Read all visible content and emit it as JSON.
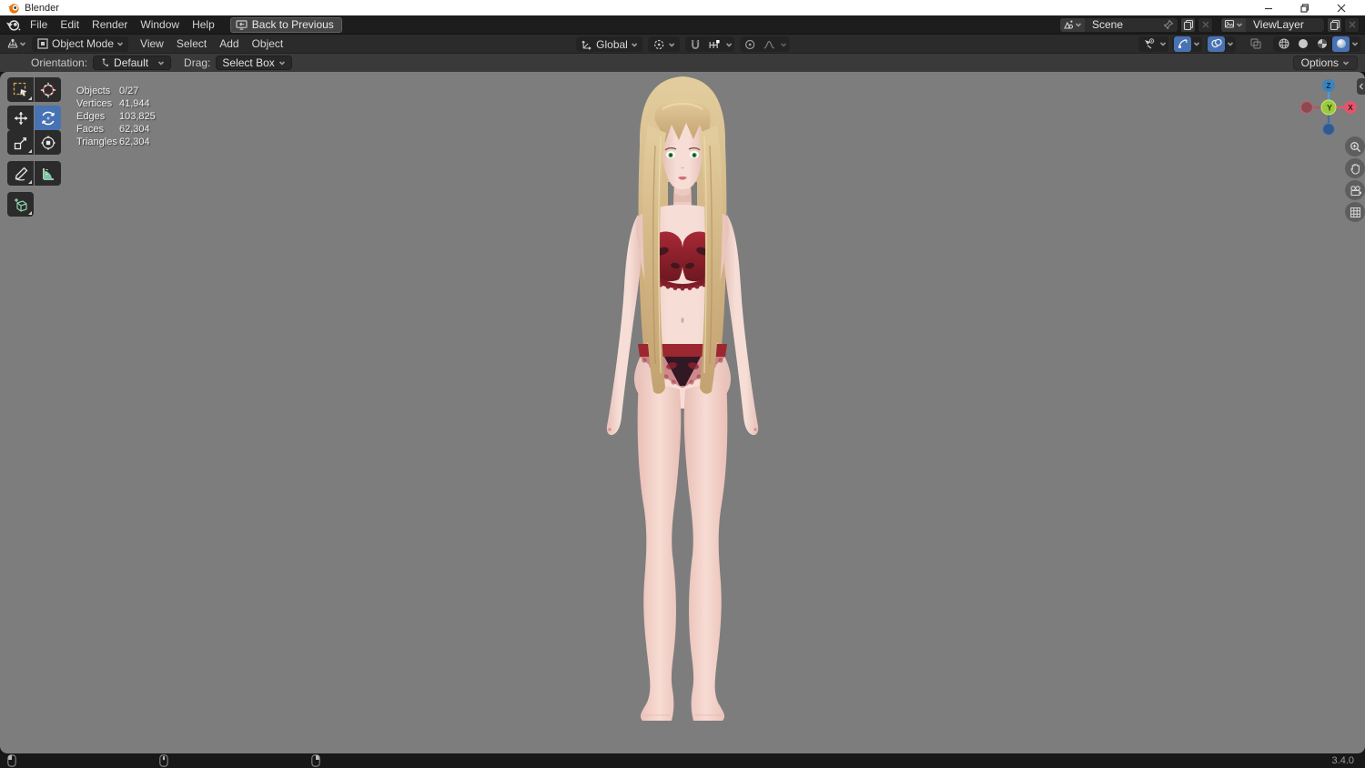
{
  "window": {
    "title": "Blender"
  },
  "topbar": {
    "menus": [
      "File",
      "Edit",
      "Render",
      "Window",
      "Help"
    ],
    "back_button": "Back to Previous",
    "scene": {
      "value": "Scene"
    },
    "view_layer": {
      "value": "ViewLayer"
    }
  },
  "viewport_header": {
    "mode": "Object Mode",
    "menus": [
      "View",
      "Select",
      "Add",
      "Object"
    ],
    "transform_orientation": "Global"
  },
  "tool_settings": {
    "orientation_label": "Orientation:",
    "orientation_value": "Default",
    "drag_label": "Drag:",
    "drag_value": "Select Box",
    "options_label": "Options"
  },
  "stats": {
    "rows": [
      {
        "label": "Objects",
        "value": "0/27"
      },
      {
        "label": "Vertices",
        "value": "41,944"
      },
      {
        "label": "Edges",
        "value": "103,825"
      },
      {
        "label": "Faces",
        "value": "62,304"
      },
      {
        "label": "Triangles",
        "value": "62,304"
      }
    ]
  },
  "gizmo": {
    "axes": {
      "x": "X",
      "y": "Y",
      "z": "Z"
    }
  },
  "statusbar": {
    "version": "3.4.0"
  },
  "colors": {
    "accent_active": "#4772b3",
    "viewport_bg": "#7d7d7d",
    "axis_x": "#e2566b",
    "axis_y": "#9bcb3c",
    "axis_z": "#3b83bd",
    "bra_red": "#8e1f2a",
    "hair_blonde": "#d6bc8c"
  },
  "icons": [
    "blender-logo",
    "monitor-back",
    "scene",
    "view-layer",
    "pin",
    "copy",
    "close",
    "editor-type",
    "object-mode",
    "orientation-axis",
    "pivot",
    "magnet",
    "increment-snap",
    "proportional",
    "falloff",
    "visibility-filter",
    "gizmo-toggle",
    "overlays",
    "xray",
    "wireframe-shading",
    "solid-shading",
    "material-shading",
    "rendered-shading",
    "box-select",
    "cursor-3d",
    "move",
    "rotate",
    "scale",
    "transform",
    "annotate",
    "measure",
    "add-cube",
    "zoom",
    "pan-hand",
    "camera-view",
    "ortho-grid",
    "left-mouse",
    "middle-mouse",
    "right-mouse"
  ]
}
